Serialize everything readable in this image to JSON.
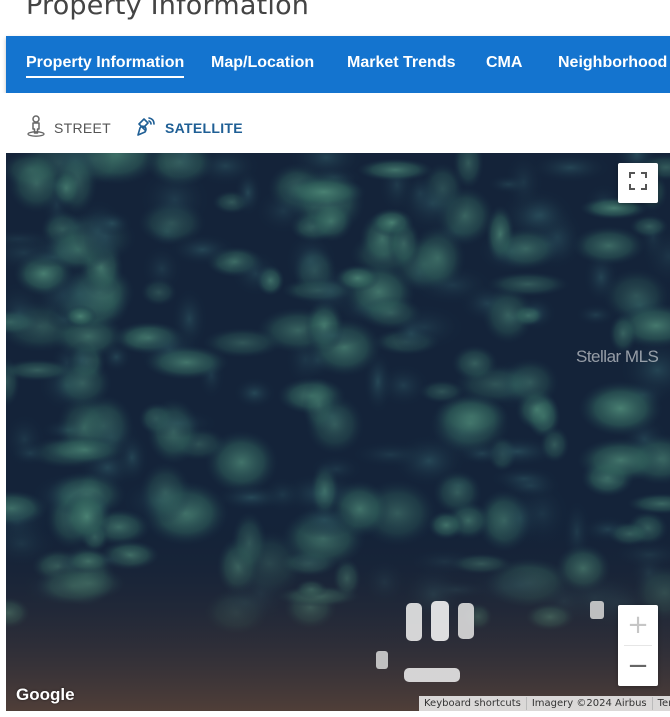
{
  "page": {
    "title": "Property Information"
  },
  "tabs": [
    {
      "label": "Property Information",
      "active": true
    },
    {
      "label": "Map/Location",
      "active": false
    },
    {
      "label": "Market Trends",
      "active": false
    },
    {
      "label": "CMA",
      "active": false
    },
    {
      "label": "Neighborhood",
      "active": false
    }
  ],
  "map_types": [
    {
      "label": "STREET",
      "icon": "street-view-person-icon",
      "selected": false
    },
    {
      "label": "SATELLITE",
      "icon": "satellite-icon",
      "selected": true
    }
  ],
  "map": {
    "view": "satellite",
    "watermark": "Stellar MLS",
    "google_logo": "Google",
    "controls": {
      "fullscreen_icon": "fullscreen-icon",
      "zoom_in": "+",
      "zoom_out": "−",
      "zoom_in_disabled": true
    },
    "attribution": {
      "keyboard_shortcuts": "Keyboard shortcuts",
      "imagery": "Imagery ©2024 Airbus",
      "terms": "Terms"
    }
  },
  "colors": {
    "tab_bar": "#1474cf",
    "tab_text": "#ffffff",
    "selected_map_type": "#1f5f95",
    "unselected_map_type": "#555555"
  }
}
